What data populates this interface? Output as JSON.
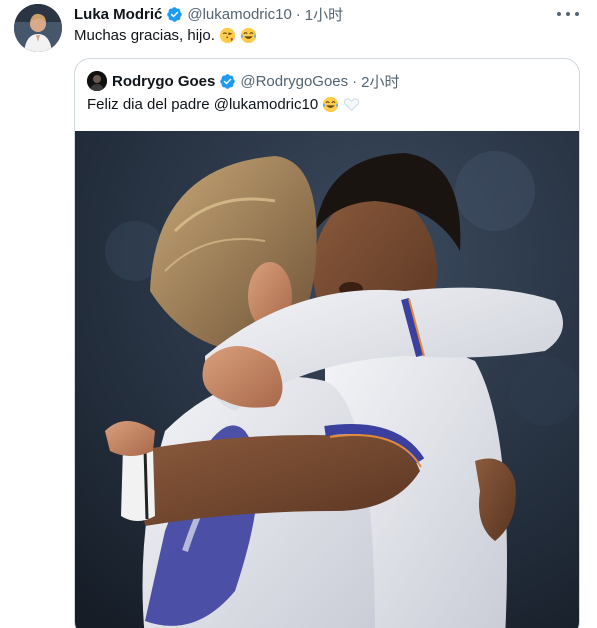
{
  "tweet": {
    "author_name": "Luka Modrić",
    "author_handle": "@lukamodric10",
    "separator": "·",
    "time": "1小时",
    "text": "Muchas gracias, hijo.",
    "emojis": [
      "face-blowing-kiss-icon",
      "tears-of-joy-icon"
    ]
  },
  "quoted_tweet": {
    "author_name": "Rodrygo Goes",
    "author_handle": "@RodrygoGoes",
    "separator": "·",
    "time": "2小时",
    "text": "Feliz dia del padre @lukamodric10",
    "emojis": [
      "tears-of-joy-icon",
      "white-heart-icon"
    ]
  },
  "colors": {
    "verified": "#1d9bf0",
    "secondary_text": "#536471",
    "border": "#cfd9de"
  }
}
